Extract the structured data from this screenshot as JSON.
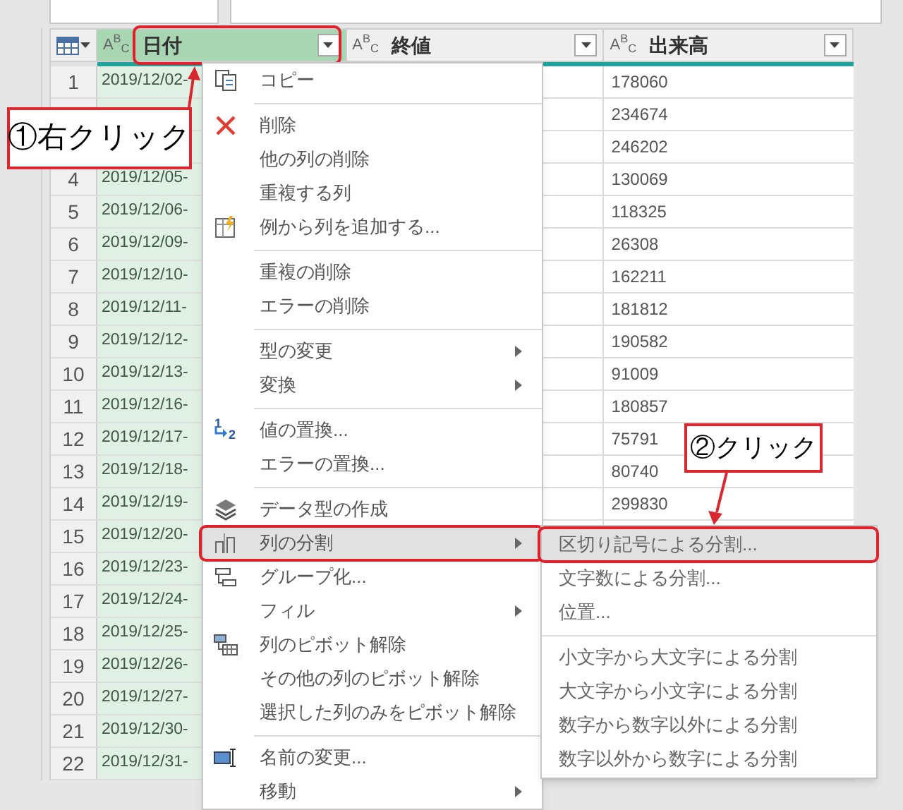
{
  "table": {
    "columns": [
      {
        "type_label": "A$^{B}$$_{C}$",
        "name": "日付",
        "selected": true
      },
      {
        "type_label": "A$^{B}$$_{C}$",
        "name": "終値",
        "selected": false
      },
      {
        "type_label": "A$^{B}$$_{C}$",
        "name": "出来高",
        "selected": false
      }
    ],
    "rows": [
      {
        "number": "1",
        "date": "2019/12/02-",
        "volume": "178060"
      },
      {
        "volume": "234674"
      },
      {
        "volume": "246202"
      },
      {
        "number": "4",
        "date": "2019/12/05-",
        "volume": "130069"
      },
      {
        "number": "5",
        "date": "2019/12/06-",
        "volume": "118325"
      },
      {
        "number": "6",
        "date": "2019/12/09-",
        "volume": "26308"
      },
      {
        "number": "7",
        "date": "2019/12/10-",
        "volume": "162211"
      },
      {
        "number": "8",
        "date": "2019/12/11-",
        "volume": "181812"
      },
      {
        "number": "9",
        "date": "2019/12/12-",
        "volume": "190582"
      },
      {
        "number": "10",
        "date": "2019/12/13-",
        "volume": "91009"
      },
      {
        "number": "11",
        "date": "2019/12/16-",
        "volume": "180857"
      },
      {
        "number": "12",
        "date": "2019/12/17-",
        "volume": "75791"
      },
      {
        "number": "13",
        "date": "2019/12/18-",
        "volume": "80740"
      },
      {
        "number": "14",
        "date": "2019/12/19-",
        "volume": "299830"
      },
      {
        "number": "15",
        "date": "2019/12/20-"
      },
      {
        "number": "16",
        "date": "2019/12/23-"
      },
      {
        "number": "17",
        "date": "2019/12/24-"
      },
      {
        "number": "18",
        "date": "2019/12/25-"
      },
      {
        "number": "19",
        "date": "2019/12/26-"
      },
      {
        "number": "20",
        "date": "2019/12/27-"
      },
      {
        "number": "21",
        "date": "2019/12/30-"
      },
      {
        "number": "22",
        "date": "2019/12/31-"
      }
    ]
  },
  "context_menu": {
    "items": [
      {
        "kind": "item",
        "label": "コピー",
        "has_submenu": false,
        "selected": false
      },
      {
        "kind": "separator"
      },
      {
        "kind": "item",
        "label": "削除",
        "has_submenu": false,
        "selected": false
      },
      {
        "kind": "item",
        "label": "他の列の削除",
        "has_submenu": false,
        "selected": false
      },
      {
        "kind": "item",
        "label": "重複する列",
        "has_submenu": false,
        "selected": false
      },
      {
        "kind": "item",
        "label": "例から列を追加する...",
        "has_submenu": false,
        "selected": false
      },
      {
        "kind": "separator"
      },
      {
        "kind": "item",
        "label": "重複の削除",
        "has_submenu": false,
        "selected": false
      },
      {
        "kind": "item",
        "label": "エラーの削除",
        "has_submenu": false,
        "selected": false
      },
      {
        "kind": "separator"
      },
      {
        "kind": "item",
        "label": "型の変更",
        "has_submenu": true,
        "selected": false
      },
      {
        "kind": "item",
        "label": "変換",
        "has_submenu": true,
        "selected": false
      },
      {
        "kind": "separator"
      },
      {
        "kind": "item",
        "label": "値の置換...",
        "icon_digits": [
          "1",
          "2"
        ],
        "has_submenu": false,
        "selected": false
      },
      {
        "kind": "item",
        "label": "エラーの置換...",
        "has_submenu": false,
        "selected": false
      },
      {
        "kind": "separator"
      },
      {
        "kind": "item",
        "label": "データ型の作成",
        "has_submenu": false,
        "selected": false
      },
      {
        "kind": "item",
        "label": "列の分割",
        "has_submenu": true,
        "selected": true
      },
      {
        "kind": "item",
        "label": "グループ化...",
        "has_submenu": false,
        "selected": false
      },
      {
        "kind": "item",
        "label": "フィル",
        "has_submenu": true,
        "selected": false
      },
      {
        "kind": "item",
        "label": "列のピボット解除",
        "has_submenu": false,
        "selected": false
      },
      {
        "kind": "item",
        "label": "その他の列のピボット解除",
        "has_submenu": false,
        "selected": false
      },
      {
        "kind": "item",
        "label": "選択した列のみをピボット解除",
        "has_submenu": false,
        "selected": false
      },
      {
        "kind": "separator"
      },
      {
        "kind": "item",
        "label": "名前の変更...",
        "has_submenu": false,
        "selected": false
      },
      {
        "kind": "item",
        "label": "移動",
        "has_submenu": true,
        "selected": false
      }
    ]
  },
  "submenu": {
    "items": [
      {
        "kind": "item",
        "label": "区切り記号による分割...",
        "selected": true
      },
      {
        "kind": "item",
        "label": "文字数による分割...",
        "selected": false
      },
      {
        "kind": "item",
        "label": "位置...",
        "selected": false
      },
      {
        "kind": "separator"
      },
      {
        "kind": "item",
        "label": "小文字から大文字による分割",
        "selected": false
      },
      {
        "kind": "item",
        "label": "大文字から小文字による分割",
        "selected": false
      },
      {
        "kind": "item",
        "label": "数字から数字以外による分割",
        "selected": false
      },
      {
        "kind": "item",
        "label": "数字以外から数字による分割",
        "selected": false
      }
    ]
  },
  "annotations": [
    {
      "kind": "callout",
      "text": "①右クリック"
    },
    {
      "kind": "callout",
      "text": "②クリック"
    }
  ]
}
